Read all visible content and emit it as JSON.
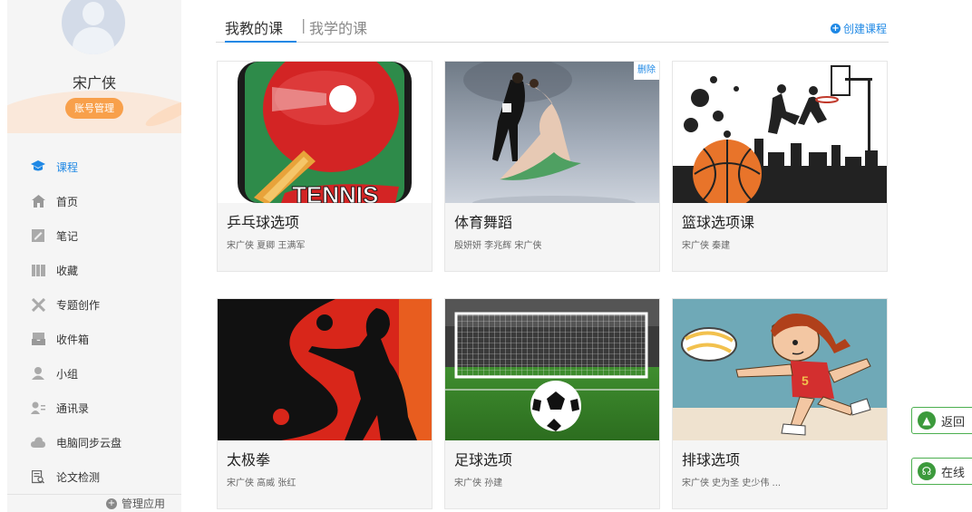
{
  "sidebar": {
    "user_name": "宋广侠",
    "account_button": "账号管理",
    "nav": [
      {
        "label": "课程",
        "icon": "course-icon",
        "active": true
      },
      {
        "label": "首页",
        "icon": "home-icon",
        "active": false
      },
      {
        "label": "笔记",
        "icon": "note-icon",
        "active": false
      },
      {
        "label": "收藏",
        "icon": "bookmark-icon",
        "active": false
      },
      {
        "label": "专题创作",
        "icon": "topic-icon",
        "active": false
      },
      {
        "label": "收件箱",
        "icon": "inbox-icon",
        "active": false
      },
      {
        "label": "小组",
        "icon": "group-icon",
        "active": false
      },
      {
        "label": "通讯录",
        "icon": "contacts-icon",
        "active": false
      },
      {
        "label": "电脑同步云盘",
        "icon": "cloud-icon",
        "active": false
      },
      {
        "label": "论文检测",
        "icon": "paper-check-icon",
        "active": false
      }
    ],
    "manage_apps": "管理应用"
  },
  "tabs": {
    "active": "我教的课",
    "separator": "|",
    "inactive": "我学的课",
    "create_course": "创建课程"
  },
  "courses": [
    {
      "title": "乒乓球选项",
      "teachers": "宋广侠 夏卿 王满军",
      "image": "table-tennis",
      "image_text": "TENNIS"
    },
    {
      "title": "体育舞蹈",
      "teachers": "殷妍妍 李兆辉 宋广侠",
      "image": "dance",
      "delete_label": "删除"
    },
    {
      "title": "篮球选项课",
      "teachers": "宋广侠 秦建",
      "image": "basketball"
    },
    {
      "title": "太极拳",
      "teachers": "宋广侠 高威 张红",
      "image": "taichi"
    },
    {
      "title": "足球选项",
      "teachers": "宋广侠 孙建",
      "image": "soccer"
    },
    {
      "title": "排球选项",
      "teachers": "宋广侠 史为圣 史少伟 ...",
      "image": "volleyball"
    }
  ],
  "float": {
    "back_top": "返回",
    "online": "在线"
  },
  "colors": {
    "accent": "#1e88e5",
    "account_button": "#f8a04b",
    "float_border": "#4caf50"
  }
}
